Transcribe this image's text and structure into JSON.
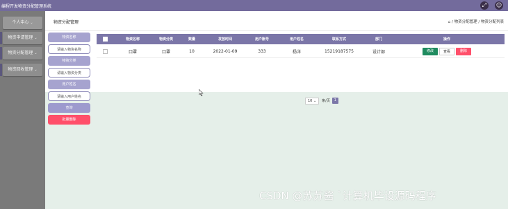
{
  "topbar": {
    "title": "编程开发物资分配管理系统",
    "icons": [
      "expand-icon",
      "user-icon"
    ]
  },
  "sidebar": {
    "items": [
      {
        "label": "个人中心"
      },
      {
        "label": "物资申请管理"
      },
      {
        "label": "物资分配管理"
      },
      {
        "label": "物资回收管理"
      }
    ]
  },
  "header": {
    "page_title": "物资分配管理",
    "breadcrumb": "⌂ / 物资分配管理 / 物资分配列表"
  },
  "search": {
    "field1_label": "物资名称",
    "field1_placeholder": "请输入物资名称",
    "field2_label": "物资分类",
    "field2_placeholder": "请输入物资分类",
    "field3_label": "用户姓名",
    "field3_placeholder": "请输入用户姓名",
    "query_label": "查询",
    "batch_delete_label": "批量删除"
  },
  "table": {
    "columns": [
      "物资名称",
      "物资分类",
      "数量",
      "发放时间",
      "用户账号",
      "用户姓名",
      "联系方式",
      "部门",
      "操作"
    ],
    "rows": [
      [
        "口罩",
        "口罩",
        "10",
        "2022-01-09",
        "333",
        "杨洋",
        "15219187575",
        "设计部"
      ]
    ],
    "actions": {
      "edit": "修改",
      "view": "查看",
      "delete": "删除"
    }
  },
  "pagination": {
    "page_size": "10",
    "page_size_suffix": "条/页",
    "current_page": "1"
  },
  "watermark": "CSDN @苏苏酱    `计算机毕设源码程序",
  "colors": {
    "topbar": "#736b9c",
    "sidebar": "#7a7a7a",
    "table_header": "#7b76a8",
    "danger": "#ff4f6a",
    "edit": "#1f8b5f"
  }
}
